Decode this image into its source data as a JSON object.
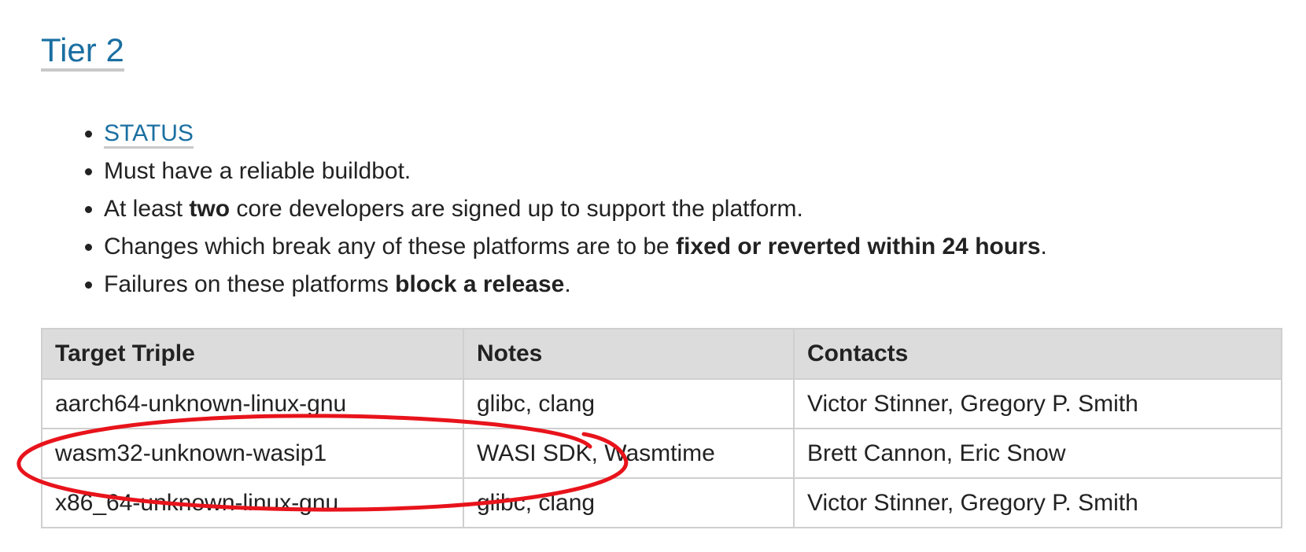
{
  "section": {
    "title": "Tier 2"
  },
  "rules": {
    "status_link": "STATUS",
    "item2": "Must have a reliable buildbot.",
    "item3": {
      "pre": "At least ",
      "bold": "two",
      "post": " core developers are signed up to support the platform."
    },
    "item4": {
      "pre": "Changes which break any of these platforms are to be ",
      "bold": "fixed or reverted within 24 hours",
      "post": "."
    },
    "item5": {
      "pre": "Failures on these platforms ",
      "bold": "block a release",
      "post": "."
    }
  },
  "table": {
    "headers": [
      "Target Triple",
      "Notes",
      "Contacts"
    ],
    "rows": [
      [
        "aarch64-unknown-linux-gnu",
        "glibc, clang",
        "Victor Stinner, Gregory P. Smith"
      ],
      [
        "wasm32-unknown-wasip1",
        "WASI SDK, Wasmtime",
        "Brett Cannon, Eric Snow"
      ],
      [
        "x86_64-unknown-linux-gnu",
        "glibc, clang",
        "Victor Stinner, Gregory P. Smith"
      ]
    ]
  },
  "annotation": {
    "color": "#e8131b"
  }
}
